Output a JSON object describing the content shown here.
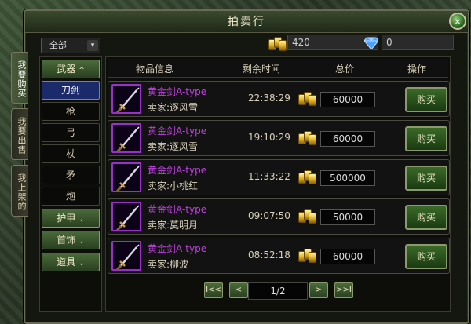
{
  "window": {
    "title": "拍卖行",
    "close_glyph": "×"
  },
  "side_tabs": [
    {
      "label": "我要购买",
      "active": true
    },
    {
      "label": "我要出售",
      "active": false
    },
    {
      "label": "我上架的",
      "active": false
    }
  ],
  "filter": {
    "selected": "全部",
    "dropdown_glyph": "▾"
  },
  "currency": {
    "gold": "420",
    "diamond": "0",
    "gold_icon": "gold-ingot-icon",
    "diamond_icon": "diamond-icon"
  },
  "categories": {
    "weapons": {
      "label": "武器",
      "chevron": "^"
    },
    "weapon_subs": [
      "刀剑",
      "枪",
      "弓",
      "杖",
      "矛",
      "炮"
    ],
    "armor": {
      "label": "护甲",
      "chevron": "⌄"
    },
    "jewelry": {
      "label": "首饰",
      "chevron": "⌄"
    },
    "props": {
      "label": "道具",
      "chevron": "⌄"
    }
  },
  "table": {
    "headers": {
      "item_info": "物品信息",
      "remaining_time": "剩余时间",
      "total_price": "总价",
      "action": "操作"
    },
    "rows": [
      {
        "name": "黄金剑A-type",
        "seller": "卖家:逐风雪",
        "time": "22:38:29",
        "price": "60000",
        "buy": "购买"
      },
      {
        "name": "黄金剑A-type",
        "seller": "卖家:逐风雪",
        "time": "19:10:29",
        "price": "60000",
        "buy": "购买"
      },
      {
        "name": "黄金剑A-type",
        "seller": "卖家:小桃红",
        "time": "11:33:22",
        "price": "500000",
        "buy": "购买"
      },
      {
        "name": "黄金剑A-type",
        "seller": "卖家:莫明月",
        "time": "09:07:50",
        "price": "50000",
        "buy": "购买"
      },
      {
        "name": "黄金剑A-type",
        "seller": "卖家:柳波",
        "time": "08:52:18",
        "price": "60000",
        "buy": "购买"
      }
    ]
  },
  "pagination": {
    "first": "I<<",
    "prev": "<",
    "page": "1/2",
    "next": ">",
    "last": ">>I"
  },
  "colors": {
    "item_name": "#c040e0",
    "button_green": "#3a6a28",
    "selected_blue": "#1a2a6a"
  }
}
